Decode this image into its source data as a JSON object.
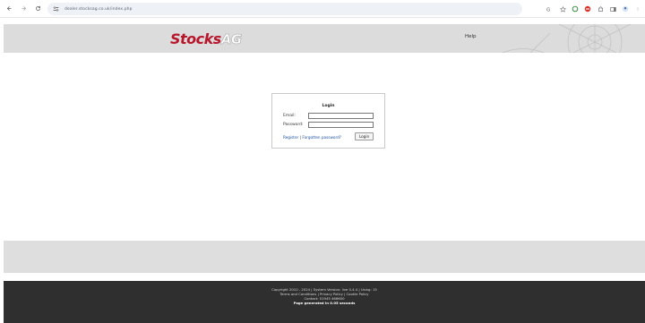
{
  "browser": {
    "url": "dealer.stocksag.co.uk/index.php",
    "colors": {
      "bar": "#ffffff",
      "pill": "#eef1f5"
    }
  },
  "header": {
    "logo_main": "Stocks",
    "logo_suffix": "AG",
    "help_label": "Help",
    "colors": {
      "background": "#dcdcdc",
      "logo": "#b7162b"
    }
  },
  "login": {
    "title": "Login",
    "email_label": "Email:",
    "email_value": "",
    "password_label": "Password:",
    "password_value": "",
    "register_label": "Register",
    "separator": "|",
    "forgot_label": "Forgotten password?",
    "button_label": "Login"
  },
  "footer": {
    "line1": "Copyright 2010 - 2024 | System Version: live 0.4.4 | Using: 15",
    "line2": "Terms and Conditions | Privacy Policy | Cookie Policy",
    "line3": "Contact: 01945 466600",
    "line4": "Page generated in 0.05 seconds",
    "colors": {
      "background": "#2f2f2f",
      "band": "#dedede"
    }
  }
}
